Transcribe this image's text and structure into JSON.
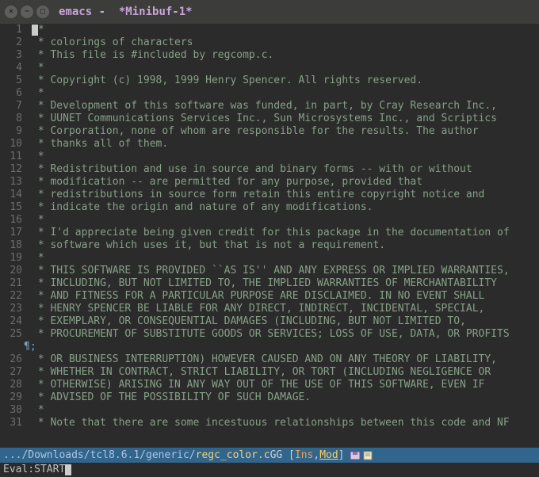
{
  "title_bar": {
    "app": "emacs",
    "buffer": "*Minibuf-1*"
  },
  "lines": [
    "/*",
    " * colorings of characters",
    " * This file is #included by regcomp.c.",
    " *",
    " * Copyright (c) 1998, 1999 Henry Spencer. All rights reserved.",
    " *",
    " * Development of this software was funded, in part, by Cray Research Inc.,",
    " * UUNET Communications Services Inc., Sun Microsystems Inc., and Scriptics",
    " * Corporation, none of whom are responsible for the results. The author",
    " * thanks all of them.",
    " *",
    " * Redistribution and use in source and binary forms -- with or without",
    " * modification -- are permitted for any purpose, provided that",
    " * redistributions in source form retain this entire copyright notice and",
    " * indicate the origin and nature of any modifications.",
    " *",
    " * I'd appreciate being given credit for this package in the documentation of",
    " * software which uses it, but that is not a requirement.",
    " *",
    " * THIS SOFTWARE IS PROVIDED ``AS IS'' AND ANY EXPRESS OR IMPLIED WARRANTIES,",
    " * INCLUDING, BUT NOT LIMITED TO, THE IMPLIED WARRANTIES OF MERCHANTABILITY",
    " * AND FITNESS FOR A PARTICULAR PURPOSE ARE DISCLAIMED. IN NO EVENT SHALL",
    " * HENRY SPENCER BE LIABLE FOR ANY DIRECT, INDIRECT, INCIDENTAL, SPECIAL,",
    " * EXEMPLARY, OR CONSEQUENTIAL DAMAGES (INCLUDING, BUT NOT LIMITED TO,",
    " * PROCUREMENT OF SUBSTITUTE GOODS OR SERVICES; LOSS OF USE, DATA, OR PROFITS",
    " * OR BUSINESS INTERRUPTION) HOWEVER CAUSED AND ON ANY THEORY OF LIABILITY,",
    " * WHETHER IN CONTRACT, STRICT LIABILITY, OR TORT (INCLUDING NEGLIGENCE OR",
    " * OTHERWISE) ARISING IN ANY WAY OUT OF THE USE OF THIS SOFTWARE, EVEN IF",
    " * ADVISED OF THE POSSIBILITY OF SUCH DAMAGE.",
    " *",
    " * Note that there are some incestuous relationships between this code and NF"
  ],
  "pilcrow_after_line": 25,
  "pilcrow_char": "¶;",
  "mode_line": {
    "path_prefix": ".../Downloads/tcl8.6.1/generic/",
    "file": "regc_color.c",
    "after_file": " GG [",
    "ins": "Ins",
    "comma": ",",
    "mod": "Mod",
    "close": "]"
  },
  "minibuffer": {
    "prompt": "Eval: ",
    "input": "START"
  }
}
